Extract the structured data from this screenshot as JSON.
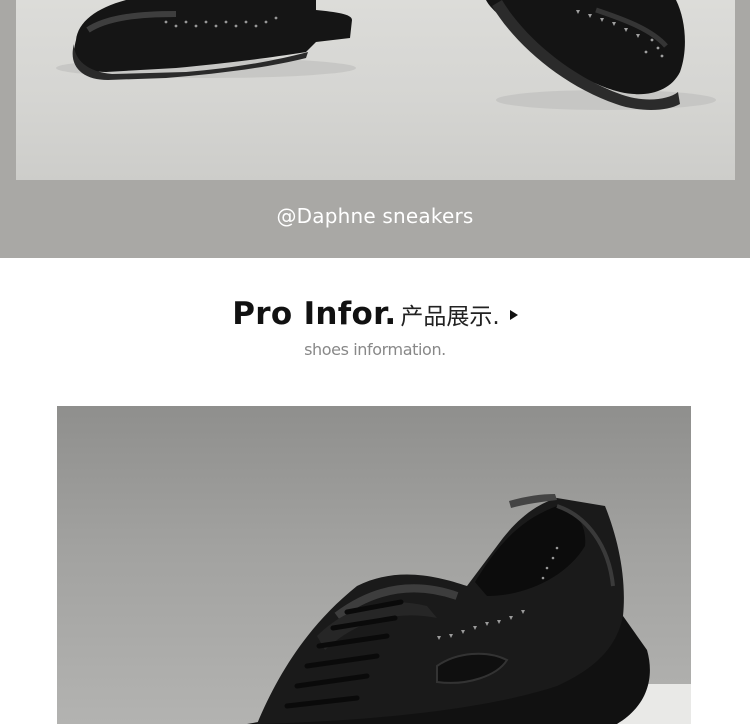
{
  "banner": {
    "caption": "@Daphne sneakers"
  },
  "section": {
    "title_en": "Pro Infor.",
    "title_cn": "产品展示.",
    "subtitle": "shoes information."
  },
  "icons": {
    "arrow": "play-triangle-icon"
  },
  "colors": {
    "banner_bg": "#a9a8a5",
    "photo_bg": "#d8d8d5",
    "shoe": "#141414"
  }
}
